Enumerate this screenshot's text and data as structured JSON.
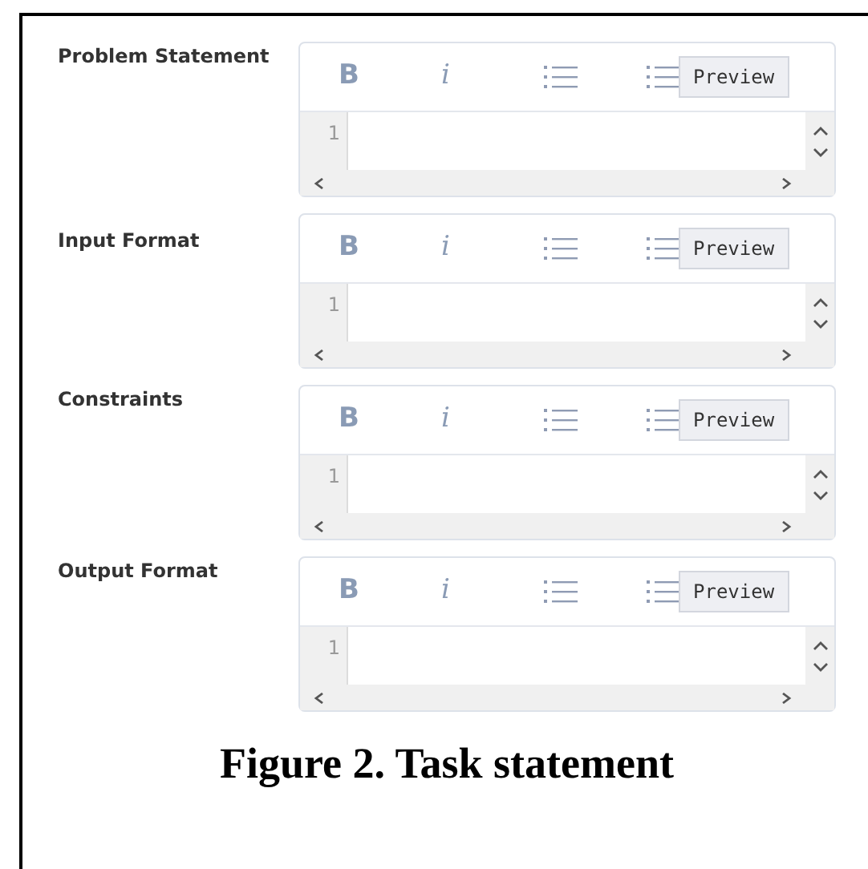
{
  "fields": [
    {
      "label": "Problem Statement",
      "bold_button": "B",
      "italic_button": "i",
      "preview_button": "Preview",
      "line_number": "1"
    },
    {
      "label": "Input Format",
      "bold_button": "B",
      "italic_button": "i",
      "preview_button": "Preview",
      "line_number": "1"
    },
    {
      "label": "Constraints",
      "bold_button": "B",
      "italic_button": "i",
      "preview_button": "Preview",
      "line_number": "1"
    },
    {
      "label": "Output Format",
      "bold_button": "B",
      "italic_button": "i",
      "preview_button": "Preview",
      "line_number": "1"
    }
  ],
  "caption": "Figure 2. Task statement"
}
